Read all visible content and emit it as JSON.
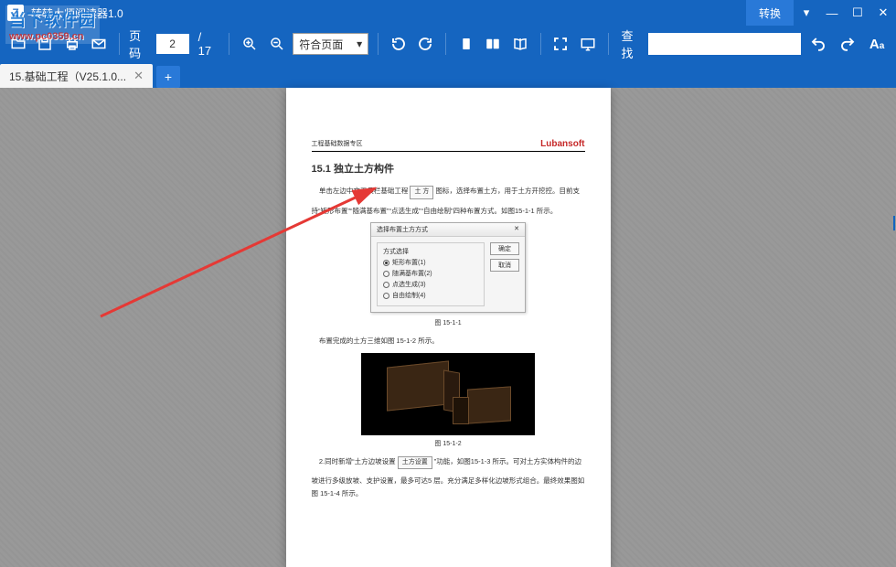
{
  "app": {
    "title": "转转大师阅读器1.0",
    "logo_letter": "Z"
  },
  "window": {
    "convert_label": "转换"
  },
  "toolbar": {
    "page_label": "页码",
    "page_current": "2",
    "page_total": "/ 17",
    "zoom_mode": "符合页面",
    "search_label": "查找"
  },
  "tabs": {
    "active": "15.基础工程（V25.1.0..."
  },
  "doc": {
    "header_left": "工程基础数据专区",
    "brand": "Lubansoft",
    "h1": "15.1 独立土方构件",
    "p1_a": "单击左边中文工具栏基础工程",
    "btn1": "土    方",
    "p1_b": "图标，选择布置土方，用于土方开挖控。目前支",
    "p2": "持“矩形布置”“随满基布置”“点选生成”“自由绘制”四种布置方式。如图15-1-1 所示。",
    "dialog": {
      "title": "选择布置土方方式",
      "group": "方式选择",
      "opt1": "矩形布置(1)",
      "opt2": "随满基布置(2)",
      "opt3": "点选生成(3)",
      "opt4": "自由绘制(4)",
      "ok": "确定",
      "cancel": "取消"
    },
    "fig1": "图 15-1-1",
    "p3": "布置完成的土方三维如图 15-1-2 所示。",
    "fig2": "图 15-1-2",
    "p4_a": "2.同时新增“土方边坡设置",
    "btn2": "土方设置",
    "p4_b": "”功能，如图15-1-3 所示。可对土方实体构件的边",
    "p5": "坡进行多级放坡、支护设置，最多可达5 层。充分满足多样化边坡形式组合。最终效果图如图 15-1-4 所示。"
  },
  "watermark": {
    "title": "当下软件园",
    "url": "www.pc0359.cn"
  }
}
